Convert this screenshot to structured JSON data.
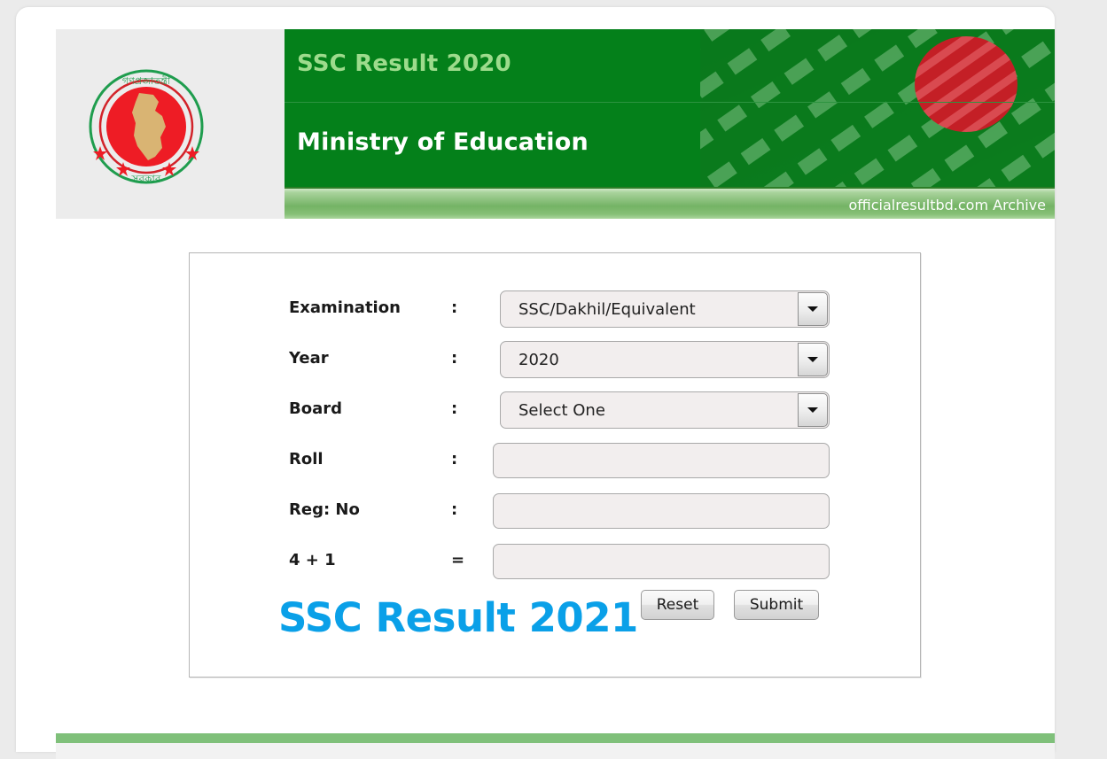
{
  "header": {
    "seal_alt": "government-of-bangladesh-seal",
    "seal_text_top": "গণপ্রজাতন্ত্রী বাংলাদেশ",
    "seal_text_bottom": "সরকার",
    "title": "SSC Result 2020",
    "ministry": "Ministry of Education",
    "archive_label": "officialresultbd.com Archive",
    "colors": {
      "green": "#04801a",
      "title_green": "#9ddb8c",
      "bar_green": "#74b365",
      "flag_red": "#d2232a"
    }
  },
  "form": {
    "rows": [
      {
        "label": "Examination",
        "separator": ":",
        "type": "select",
        "value": "SSC/Dakhil/Equivalent"
      },
      {
        "label": "Year",
        "separator": ":",
        "type": "select",
        "value": "2020"
      },
      {
        "label": "Board",
        "separator": ":",
        "type": "select",
        "value": "Select One"
      },
      {
        "label": "Roll",
        "separator": ":",
        "type": "input",
        "value": "",
        "placeholder": ""
      },
      {
        "label": "Reg: No",
        "separator": ":",
        "type": "input",
        "value": "",
        "placeholder": ""
      },
      {
        "label": "4 + 1",
        "separator": "=",
        "type": "input",
        "value": "",
        "placeholder": ""
      }
    ],
    "reset_label": "Reset",
    "submit_label": "Submit"
  },
  "overlay": {
    "title": "SSC Result 2021",
    "color": "#0aa0e8"
  },
  "footer": {
    "bar_color": "#7fc07a"
  }
}
